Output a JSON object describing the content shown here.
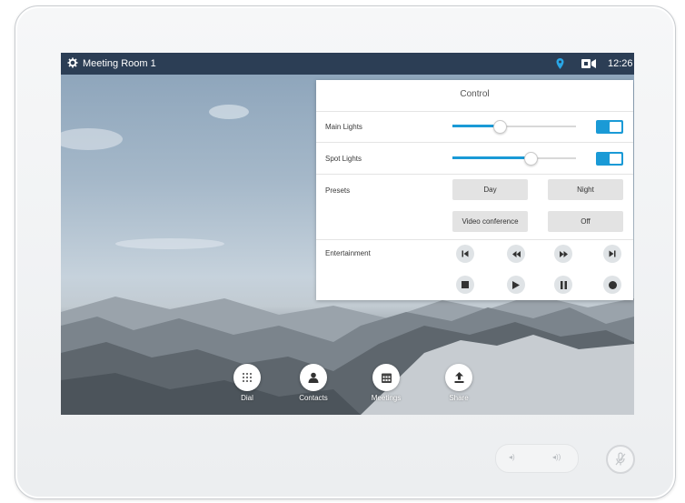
{
  "statusbar": {
    "room_name": "Meeting Room 1",
    "time": "12:26",
    "icons": [
      "gear-icon",
      "location-pin-icon",
      "camera-icon"
    ],
    "accent_color": "#2c3e55"
  },
  "control_panel": {
    "title": "Control",
    "main_lights": {
      "label": "Main Lights",
      "level": 0.38,
      "on": true
    },
    "spot_lights": {
      "label": "Spot Lights",
      "level": 0.63,
      "on": true
    },
    "presets": {
      "label": "Presets",
      "day": "Day",
      "night": "Night",
      "video_conference": "Video conference",
      "off": "Off"
    },
    "entertainment": {
      "label": "Entertainment",
      "controls": [
        "skip-previous-icon",
        "rewind-icon",
        "fast-forward-icon",
        "skip-next-icon",
        "stop-icon",
        "play-icon",
        "pause-icon",
        "record-icon"
      ]
    },
    "accent_color": "#1a9ad6"
  },
  "dock": {
    "dial": "Dial",
    "contacts": "Contacts",
    "meetings": "Meetings",
    "share": "Share"
  },
  "hardware": {
    "buttons": [
      "volume-down-icon",
      "volume-up-icon",
      "microphone-mute-icon"
    ]
  }
}
